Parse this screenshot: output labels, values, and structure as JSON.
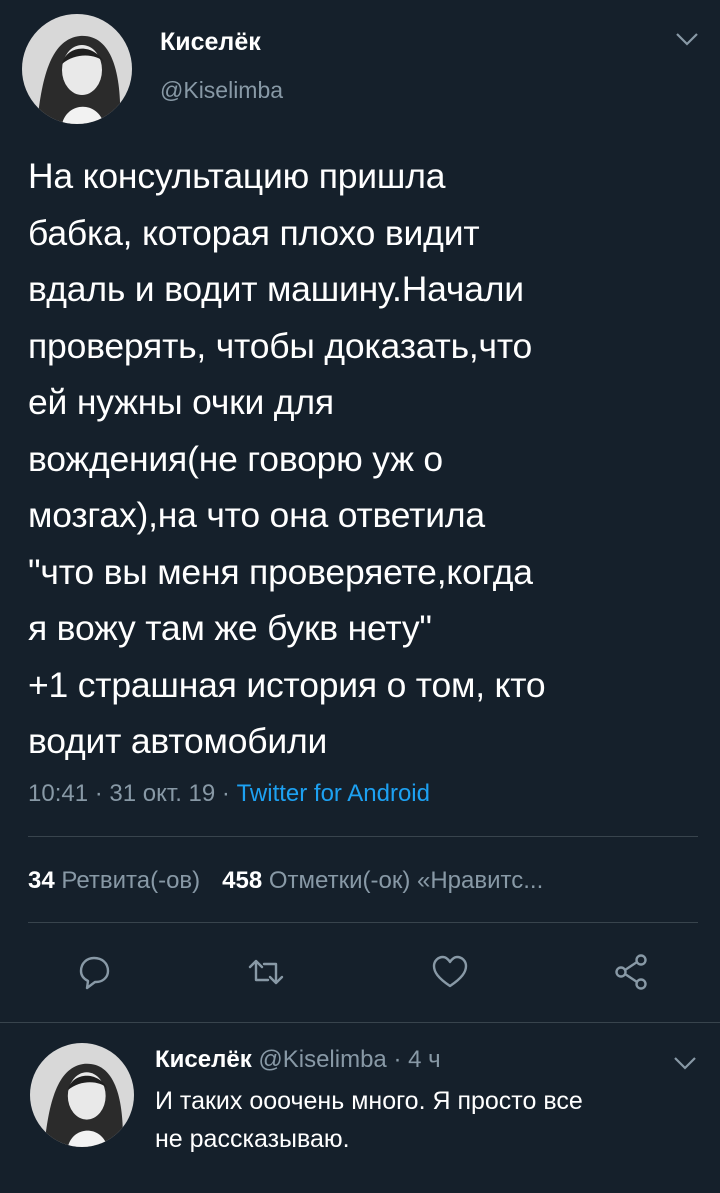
{
  "tweet": {
    "author": {
      "display_name": "Киселёк",
      "handle": "@Kiselimba",
      "avatar_icon": "avatar-photo-icon"
    },
    "text": "На консультацию пришла\nбабка, которая плохо видит\nвдаль и водит машину.Начали\nпроверять, чтобы доказать,что\nей нужны очки для\nвождения(не говорю уж о\nмозгах),на что она ответила\n\"что вы меня проверяете,когда\nя вожу там же букв нету\"\n+1 страшная история о том, кто\nводит автомобили",
    "time": "10:41",
    "date": "31 окт. 19",
    "separator": " · ",
    "source": "Twitter for Android",
    "stats": {
      "retweets_count": "34",
      "retweets_label": "Ретвита(-ов)",
      "likes_count": "458",
      "likes_label": "Отметки(-ок) «Нравитс..."
    },
    "actions": [
      "reply-icon",
      "retweet-icon",
      "like-icon",
      "share-icon"
    ]
  },
  "reply": {
    "display_name": "Киселёк",
    "handle": "@Kiselimba",
    "age": "4 ч",
    "text": "И таких ооочень много. Я просто все\nне рассказываю."
  },
  "colors": {
    "background": "#15202b",
    "text_primary": "#ffffff",
    "text_secondary": "#8899a6",
    "accent": "#1da1f2",
    "divider": "#38444d"
  }
}
